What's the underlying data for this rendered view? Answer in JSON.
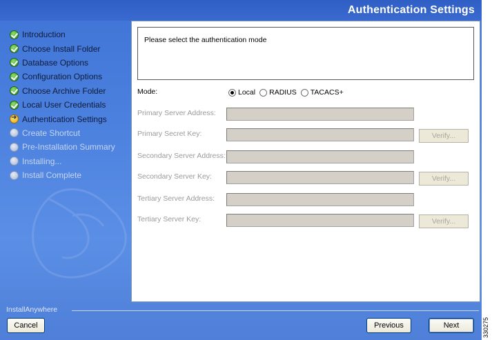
{
  "window": {
    "title": "Authentication Settings"
  },
  "steps": [
    {
      "label": "Introduction",
      "state": "done"
    },
    {
      "label": "Choose Install Folder",
      "state": "done"
    },
    {
      "label": "Database Options",
      "state": "done"
    },
    {
      "label": "Configuration Options",
      "state": "done"
    },
    {
      "label": "Choose Archive Folder",
      "state": "done"
    },
    {
      "label": "Local User Credentials",
      "state": "done"
    },
    {
      "label": "Authentication Settings",
      "state": "current"
    },
    {
      "label": "Create Shortcut",
      "state": "todo"
    },
    {
      "label": "Pre-Installation Summary",
      "state": "todo"
    },
    {
      "label": "Installing...",
      "state": "todo"
    },
    {
      "label": "Install Complete",
      "state": "todo"
    }
  ],
  "prompt": "Please select the authentication mode",
  "mode": {
    "label": "Mode:",
    "options": [
      "Local",
      "RADIUS",
      "TACACS+"
    ],
    "selected": "Local"
  },
  "fields": {
    "primary_address": {
      "label": "Primary Server Address:",
      "value": ""
    },
    "primary_key": {
      "label": "Primary Secret Key:",
      "value": ""
    },
    "secondary_address": {
      "label": "Secondary Server Address:",
      "value": ""
    },
    "secondary_key": {
      "label": "Secondary Server Key:",
      "value": ""
    },
    "tertiary_address": {
      "label": "Tertiary Server Address:",
      "value": ""
    },
    "tertiary_key": {
      "label": "Tertiary Server Key:",
      "value": ""
    }
  },
  "verify_label": "Verify...",
  "footer": {
    "brand": "InstallAnywhere",
    "cancel": "Cancel",
    "previous": "Previous",
    "next": "Next"
  },
  "figure_id": "330275",
  "icons": {
    "done": "check-circle-icon",
    "current": "arrow-right-circle-icon",
    "todo": "empty-circle-icon"
  }
}
